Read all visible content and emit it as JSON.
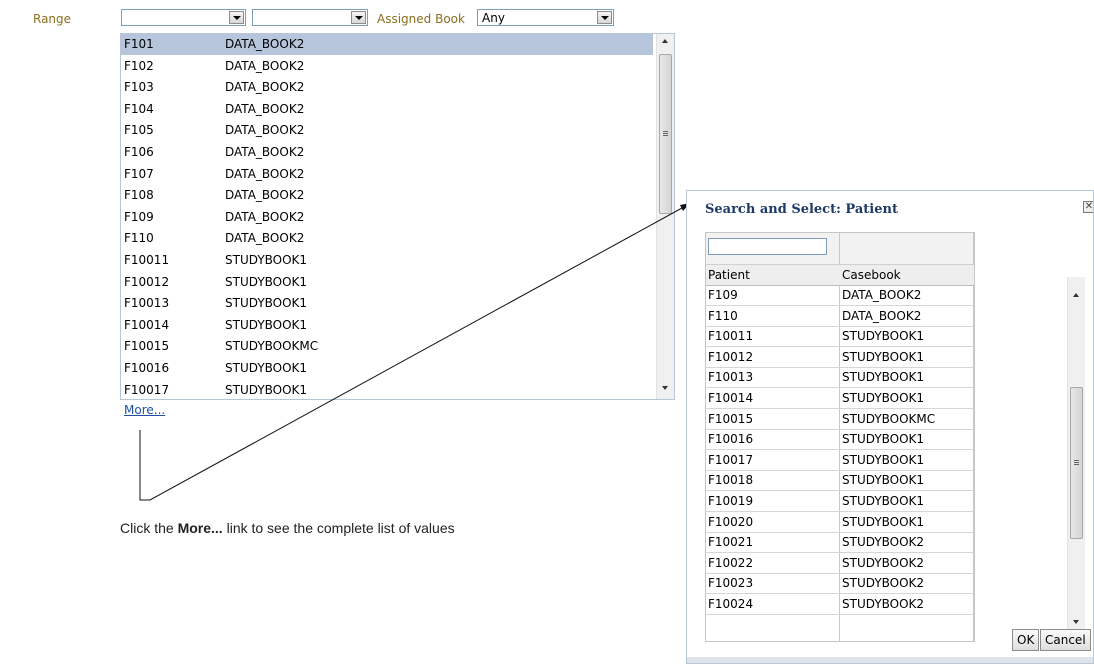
{
  "filter": {
    "range_label": "Range",
    "range_from": "",
    "range_to": "",
    "assigned_book_label": "Assigned Book",
    "assigned_book_value": "Any"
  },
  "dropdown": {
    "rows": [
      {
        "patient": "F101",
        "book": "DATA_BOOK2",
        "selected": true
      },
      {
        "patient": "F102",
        "book": "DATA_BOOK2"
      },
      {
        "patient": "F103",
        "book": "DATA_BOOK2"
      },
      {
        "patient": "F104",
        "book": "DATA_BOOK2"
      },
      {
        "patient": "F105",
        "book": "DATA_BOOK2"
      },
      {
        "patient": "F106",
        "book": "DATA_BOOK2"
      },
      {
        "patient": "F107",
        "book": "DATA_BOOK2"
      },
      {
        "patient": "F108",
        "book": "DATA_BOOK2"
      },
      {
        "patient": "F109",
        "book": "DATA_BOOK2"
      },
      {
        "patient": "F110",
        "book": "DATA_BOOK2"
      },
      {
        "patient": "F10011",
        "book": "STUDYBOOK1"
      },
      {
        "patient": "F10012",
        "book": "STUDYBOOK1"
      },
      {
        "patient": "F10013",
        "book": "STUDYBOOK1"
      },
      {
        "patient": "F10014",
        "book": "STUDYBOOK1"
      },
      {
        "patient": "F10015",
        "book": "STUDYBOOKMC"
      },
      {
        "patient": "F10016",
        "book": "STUDYBOOK1"
      },
      {
        "patient": "F10017",
        "book": "STUDYBOOK1"
      }
    ],
    "more_link": "More..."
  },
  "caption": {
    "before": "Click the ",
    "bold": "More...",
    "after": " link to see the complete list of values"
  },
  "dialog": {
    "title": "Search and Select: Patient",
    "close_glyph": "✕",
    "filter_value": "",
    "columns": [
      "Patient",
      "Casebook"
    ],
    "rows": [
      [
        "F109",
        "DATA_BOOK2"
      ],
      [
        "F110",
        "DATA_BOOK2"
      ],
      [
        "F10011",
        "STUDYBOOK1"
      ],
      [
        "F10012",
        "STUDYBOOK1"
      ],
      [
        "F10013",
        "STUDYBOOK1"
      ],
      [
        "F10014",
        "STUDYBOOK1"
      ],
      [
        "F10015",
        "STUDYBOOKMC"
      ],
      [
        "F10016",
        "STUDYBOOK1"
      ],
      [
        "F10017",
        "STUDYBOOK1"
      ],
      [
        "F10018",
        "STUDYBOOK1"
      ],
      [
        "F10019",
        "STUDYBOOK1"
      ],
      [
        "F10020",
        "STUDYBOOK1"
      ],
      [
        "F10021",
        "STUDYBOOK2"
      ],
      [
        "F10022",
        "STUDYBOOK2"
      ],
      [
        "F10023",
        "STUDYBOOK2"
      ],
      [
        "F10024",
        "STUDYBOOK2"
      ]
    ],
    "ok_label": "OK",
    "cancel_label": "Cancel"
  }
}
